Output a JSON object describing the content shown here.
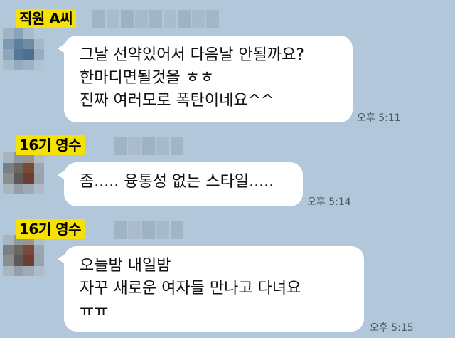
{
  "messages": [
    {
      "sender_tag": "직원 A씨",
      "lines": [
        "그날 선약있어서 다음날 안될까요?",
        "한마디면될것을 ㅎㅎ",
        "진짜 여러모로 폭탄이네요^^"
      ],
      "time": "오후 5:11"
    },
    {
      "sender_tag": "16기 영수",
      "lines": [
        "좀..... 융통성 없는 스타일....."
      ],
      "time": "오후 5:14"
    },
    {
      "sender_tag": "16기 영수",
      "lines": [
        "오늘밤 내일밤",
        "자꾸 새로운 여자들 만나고 다녀요",
        "ㅠㅠ"
      ],
      "time": "오후 5:15"
    }
  ],
  "colors": {
    "background": "#b2c7d9",
    "bubble": "#ffffff",
    "tag": "#f6e200"
  }
}
